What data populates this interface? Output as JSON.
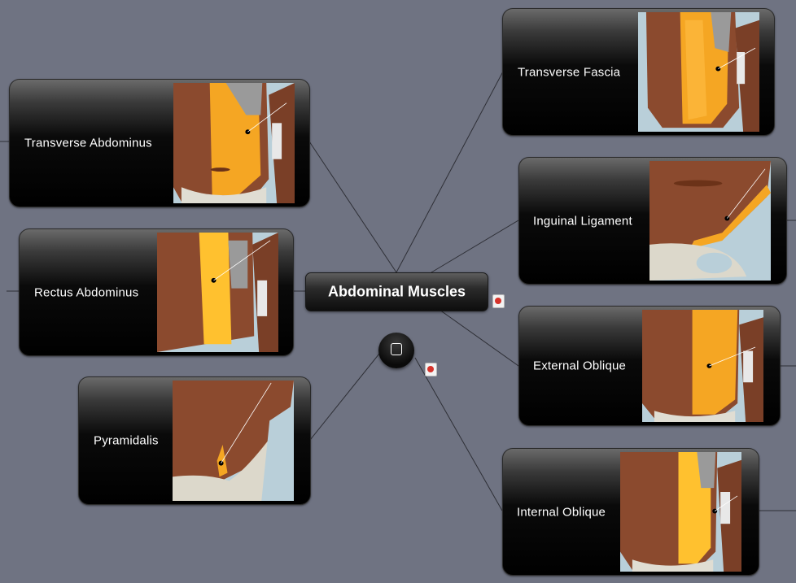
{
  "map": {
    "central_topic": "Abdominal Muscles",
    "topics": [
      {
        "id": "transverse-fascia",
        "label": "Transverse Fascia",
        "side": "right"
      },
      {
        "id": "transverse-abdominus",
        "label": "Transverse Abdominus",
        "side": "left"
      },
      {
        "id": "inguinal-ligament",
        "label": "Inguinal Ligament",
        "side": "right"
      },
      {
        "id": "rectus-abdominus",
        "label": "Rectus Abdominus",
        "side": "left"
      },
      {
        "id": "external-oblique",
        "label": "External Oblique",
        "side": "right"
      },
      {
        "id": "pyramidalis",
        "label": "Pyramidalis",
        "side": "left"
      },
      {
        "id": "internal-oblique",
        "label": "Internal Oblique",
        "side": "right"
      }
    ]
  },
  "icons": {
    "center_button": "square-outline-icon",
    "notes": "note-attachment-icon"
  },
  "colors": {
    "background": "#6f7382",
    "node_dark": "#000000",
    "highlight_muscle": "#f5a623",
    "muscle": "#8b4a2e"
  }
}
